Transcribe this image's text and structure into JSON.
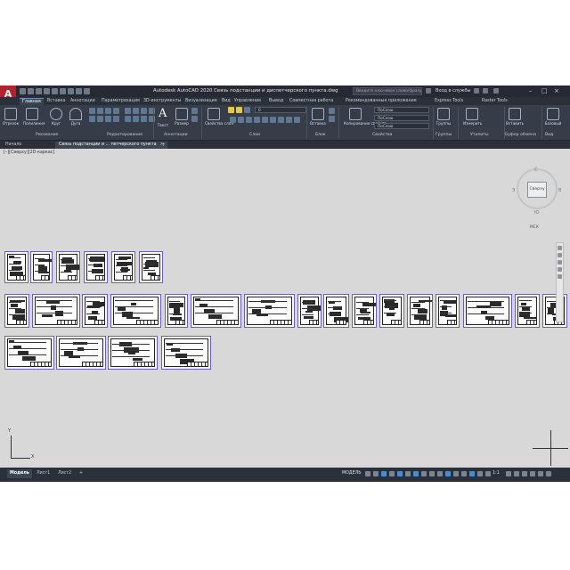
{
  "app": {
    "title": "Autodesk AutoCAD 2020   Связь подстанции и диспетчерского пункта.dwg",
    "logo": "A",
    "search_placeholder": "Введите ключевое слово/фразу",
    "signin": "Вход в службы"
  },
  "ribbon_tabs": [
    "Главная",
    "Вставка",
    "Аннотации",
    "Параметризация",
    "3D-инструменты",
    "Визуализация",
    "Вид",
    "Управление",
    "Вывод",
    "Совместная работа",
    "Рекомендованные приложения",
    "Express Tools",
    "Raster Tools"
  ],
  "ribbon": {
    "tools": {
      "line": "Отрезок",
      "polyline": "Полилиния",
      "circle": "Круг",
      "arc": "Дуга",
      "text": "Текст",
      "dimension": "Размер",
      "layer_props": "Свойства слоя",
      "insert": "Вставка",
      "match_props": "Копирование свойств",
      "groups": "Группы",
      "measure": "Измерить",
      "paste": "Вставить",
      "base": "Базовый"
    },
    "text_icon": "A",
    "layer_combo": "0",
    "bylayer1": "ПоСлою",
    "bylayer2": "ПоСлою",
    "bylayer3": "ПоСлою",
    "panels": {
      "draw": "Рисование",
      "modify": "Редактирование",
      "annotation": "Аннотации",
      "layers": "Слои",
      "block": "Блок",
      "properties": "Свойства",
      "groups": "Группы",
      "utilities": "Утилиты",
      "clipboard": "Буфер обмена",
      "view": "Вид"
    }
  },
  "doc_tabs": {
    "start": "Начало",
    "file": "Связь подстанции и ... петчерского пункта",
    "close": "×",
    "add": "+"
  },
  "canvas": {
    "view_label": "[–][Сверху][2D-каркас]",
    "cube_label": "Сверху",
    "north": "С",
    "south": "Ю",
    "west": "З",
    "east": "В",
    "wcs": "МСК",
    "ucs_x": "X",
    "ucs_y": "Y"
  },
  "layout_tabs": [
    "Модель",
    "Лист1",
    "Лист2"
  ],
  "layout_add": "+",
  "status": {
    "model": "МОДЕЛЬ",
    "scale": "1:1"
  }
}
